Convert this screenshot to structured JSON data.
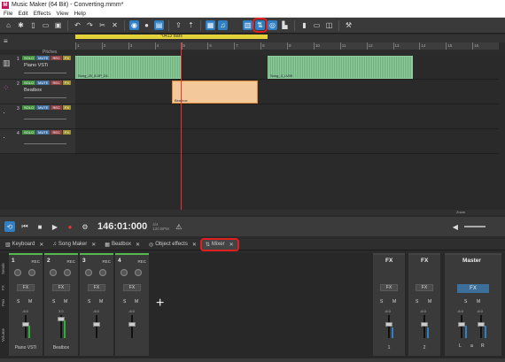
{
  "window": {
    "title": "Music Maker (64 Bit) - Converting.mmm*",
    "app_icon": "M"
  },
  "menu": [
    "File",
    "Edit",
    "Effects",
    "View",
    "Help"
  ],
  "arranger": {
    "marker_label": "*0413 Bars",
    "ruler_labels": [
      "1",
      "2",
      "3",
      "4",
      "5",
      "6",
      "7",
      "8",
      "9",
      "10",
      "11",
      "12",
      "13",
      "14",
      "15",
      "16"
    ],
    "pitches_label": "Pitches",
    "tracks": [
      {
        "num": "1",
        "name": "Piano VSTi",
        "solo": "SOLO",
        "mute": "MUTE",
        "rec": "REC",
        "fx": "FX"
      },
      {
        "num": "2",
        "name": "Beatbox",
        "solo": "SOLO",
        "mute": "MUTE",
        "rec": "REC",
        "fx": "FX"
      },
      {
        "num": "3",
        "name": "",
        "solo": "SOLO",
        "mute": "MUTE",
        "rec": "REC",
        "fx": "FX"
      },
      {
        "num": "4",
        "name": "",
        "solo": "SOLO",
        "mute": "MUTE",
        "rec": "REC",
        "fx": "FX"
      }
    ],
    "clips": [
      {
        "label": "Song_20_8-0P_D1"
      },
      {
        "label": "Song_3_LV09"
      },
      {
        "label": "Beatbox"
      }
    ],
    "zoom_label": "Zoom"
  },
  "transport": {
    "time": "146:01:000",
    "tempo": "4/4",
    "bpm": "120 BPM"
  },
  "tabs": [
    {
      "label": "Keyboard",
      "icon": "keyboard-icon"
    },
    {
      "label": "Song Maker",
      "icon": "note-icon"
    },
    {
      "label": "Beatbox",
      "icon": "grid-icon"
    },
    {
      "label": "Object effects",
      "icon": "effects-icon"
    },
    {
      "label": "Mixer",
      "icon": "mixer-icon",
      "active": true
    }
  ],
  "mixer": {
    "row_labels": {
      "sends": "Sends",
      "fx": "FX",
      "pan": "Pan",
      "volume": "Volume"
    },
    "strips": [
      {
        "num": "1",
        "rec": "REC",
        "fx": "FX",
        "s": "S",
        "m": "M",
        "value": "-6.0",
        "name": "Piano VSTi"
      },
      {
        "num": "2",
        "rec": "REC",
        "fx": "FX",
        "s": "S",
        "m": "M",
        "value": "3.0",
        "name": "Beatbox"
      },
      {
        "num": "3",
        "rec": "REC",
        "fx": "FX",
        "s": "S",
        "m": "M",
        "value": "-6.0",
        "name": ""
      },
      {
        "num": "4",
        "rec": "REC",
        "fx": "FX",
        "s": "S",
        "m": "M",
        "value": "-6.0",
        "name": ""
      }
    ],
    "fx_strips": [
      {
        "title": "FX",
        "fx": "FX",
        "s": "S",
        "m": "M",
        "value": "-6.0",
        "name": "1"
      },
      {
        "title": "FX",
        "fx": "FX",
        "s": "S",
        "m": "M",
        "value": "-6.0",
        "name": "2"
      }
    ],
    "master": {
      "title": "Master",
      "fx": "FX",
      "s": "S",
      "m": "M",
      "value_l": "-6.0",
      "value_r": "-6.0",
      "left": "L",
      "link": "a",
      "right": "R"
    },
    "add_symbol": "+"
  }
}
